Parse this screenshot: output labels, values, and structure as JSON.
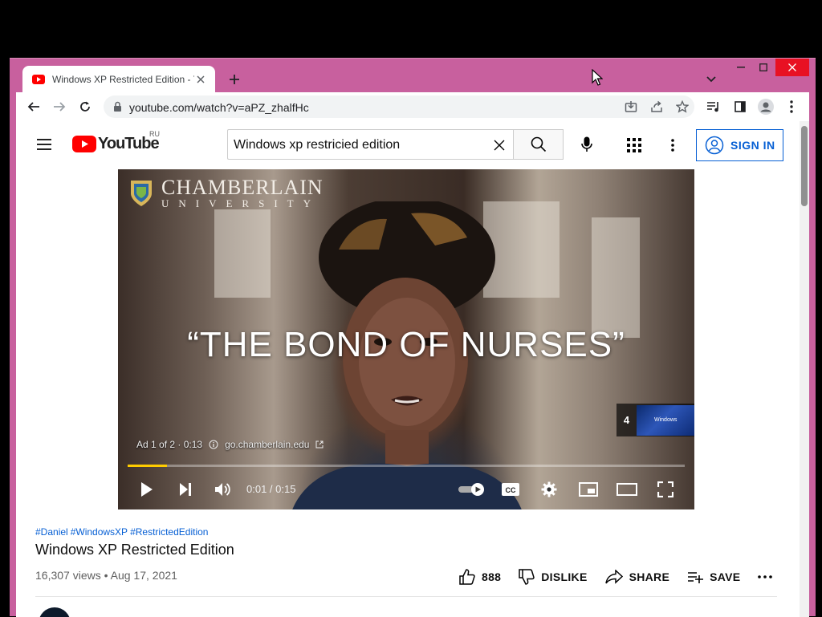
{
  "browser": {
    "tab_title": "Windows XP Restricted Edition - YouTube",
    "url": "youtube.com/watch?v=aPZ_zhalfHc",
    "frame_color": "#c8609e"
  },
  "youtube": {
    "logo_text": "YouTube",
    "region": "RU",
    "search_query": "Windows xp restricied edition",
    "sign_in_label": "SIGN IN",
    "brand_color": "#ff0000",
    "link_color": "#065fd4"
  },
  "player": {
    "ad_brand": "CHAMBERLAIN",
    "ad_brand_sub": "UNIVERSITY",
    "ad_caption": "“THE BOND OF NURSES”",
    "ad_status": "Ad 1 of 2 · 0:13",
    "ad_link": "go.chamberlain.edu",
    "skip_countdown": "4",
    "skip_preview_text": "Windows",
    "time_display": "0:01 / 0:15",
    "progress": 0.07,
    "progress_color": "#ffcc00"
  },
  "video": {
    "tags": [
      "#Daniel",
      "#WindowsXP",
      "#RestrictedEdition"
    ],
    "title": "Windows XP Restricted Edition",
    "views_date": "16,307 views • Aug 17, 2021",
    "likes": "888",
    "dislike_label": "DISLIKE",
    "share_label": "SHARE",
    "save_label": "SAVE"
  }
}
